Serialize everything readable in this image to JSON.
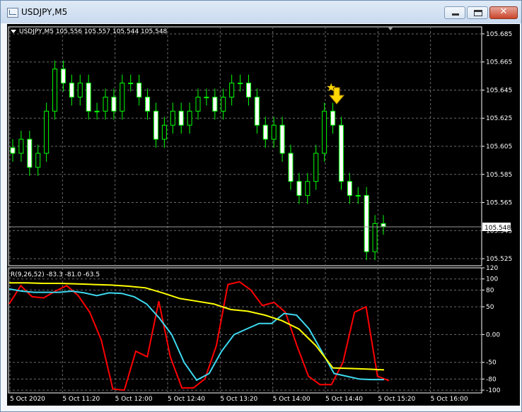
{
  "window": {
    "title": "USDJPY,M5",
    "close_glyph": "✕"
  },
  "price_panel": {
    "info": "USDJPY,M5  105.556 105.557 105.544 105.548",
    "current_price": "105.548",
    "y_ticks": [
      "105.685",
      "105.665",
      "105.645",
      "105.625",
      "105.605",
      "105.585",
      "105.565",
      "105.545",
      "105.525"
    ],
    "arrow_color": "#ffd700",
    "star_color": "#ffd700"
  },
  "indicator_panel": {
    "label": "R(9,26,52) -83.3 -81.0 -63.5",
    "y_ticks": [
      "120",
      "100",
      "80",
      "50",
      "0.00",
      "-50",
      "-80",
      "-100"
    ]
  },
  "x_ticks": [
    "5 Oct 2020",
    "5 Oct 11:20",
    "5 Oct 12:00",
    "5 Oct 12:40",
    "5 Oct 13:20",
    "5 Oct 14:00",
    "5 Oct 14:40",
    "5 Oct 15:20",
    "5 Oct 16:00"
  ],
  "colors": {
    "background": "#000000",
    "candle": "#00ff00",
    "grid": "#6b6b6b",
    "line_red": "#ff0000",
    "line_cyan": "#3dd9f0",
    "line_yellow": "#ffff00"
  },
  "chart_data": [
    {
      "type": "candlestick",
      "title": "USDJPY,M5",
      "ylim": [
        105.52,
        105.69
      ],
      "x": [
        "5 Oct 2020",
        "5 Oct 11:20",
        "5 Oct 12:00",
        "5 Oct 12:40",
        "5 Oct 13:20",
        "5 Oct 14:00",
        "5 Oct 14:40",
        "5 Oct 15:20",
        "5 Oct 16:00"
      ],
      "close_sequence": [
        105.6,
        105.61,
        105.59,
        105.6,
        105.63,
        105.66,
        105.65,
        105.64,
        105.65,
        105.63,
        105.63,
        105.64,
        105.63,
        105.65,
        105.65,
        105.64,
        105.63,
        105.61,
        105.62,
        105.63,
        105.62,
        105.63,
        105.64,
        105.64,
        105.63,
        105.64,
        105.65,
        105.65,
        105.64,
        105.62,
        105.61,
        105.62,
        105.6,
        105.58,
        105.57,
        105.58,
        105.6,
        105.63,
        105.62,
        105.58,
        105.57,
        105.57,
        105.53,
        105.55
      ],
      "last": 105.548
    },
    {
      "type": "line",
      "title": "R(9,26,52)",
      "ylim": [
        -105,
        120
      ],
      "series": [
        {
          "name": "R(9)",
          "color": "#ff0000",
          "values": [
            55,
            88,
            68,
            66,
            78,
            88,
            70,
            40,
            -10,
            -98,
            -100,
            -30,
            -40,
            60,
            -40,
            -96,
            -96,
            -80,
            -20,
            90,
            95,
            80,
            52,
            58,
            40,
            -20,
            -75,
            -90,
            -90,
            -50,
            40,
            50,
            -75,
            -83
          ]
        },
        {
          "name": "R(26)",
          "color": "#3dd9f0",
          "values": [
            82,
            78,
            76,
            76,
            76,
            78,
            75,
            70,
            75,
            74,
            68,
            55,
            30,
            0,
            -50,
            -82,
            -70,
            -30,
            0,
            10,
            20,
            20,
            38,
            35,
            10,
            -30,
            -70,
            -75,
            -80,
            -81,
            -81
          ]
        },
        {
          "name": "R(52)",
          "color": "#ffff00",
          "values": [
            93,
            93,
            92,
            92,
            91,
            90,
            89,
            87,
            84,
            75,
            65,
            60,
            55,
            45,
            42,
            35,
            25,
            10,
            -20,
            -60,
            -61,
            -62,
            -63.5
          ]
        }
      ]
    }
  ]
}
